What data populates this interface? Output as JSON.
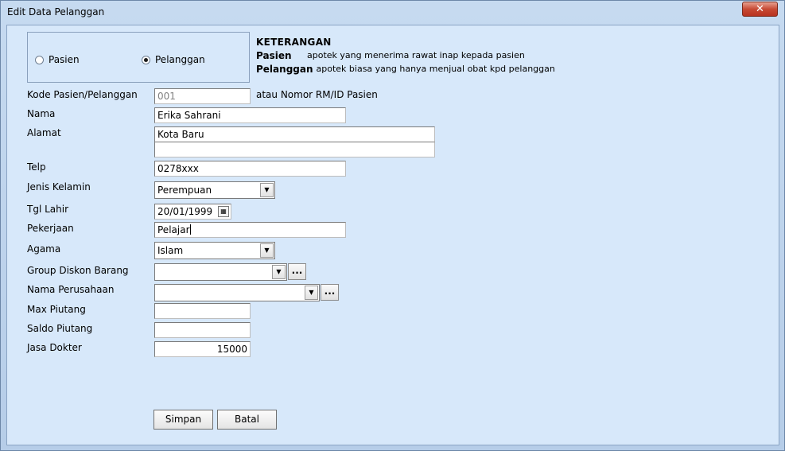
{
  "window": {
    "title": "Edit Data Pelanggan",
    "close_glyph": "✕"
  },
  "type_options": [
    {
      "label": "Pasien",
      "checked": false
    },
    {
      "label": "Pelanggan",
      "checked": true
    }
  ],
  "keterangan": {
    "title": "KETERANGAN",
    "rows": [
      {
        "term": "Pasien",
        "desc": "apotek yang menerima rawat inap kepada pasien"
      },
      {
        "term": "Pelanggan",
        "desc": "apotek biasa yang hanya menjual obat kpd pelanggan"
      }
    ]
  },
  "labels": {
    "kode": "Kode Pasien/Pelanggan",
    "kode_hint": "atau Nomor RM/ID Pasien",
    "nama": "Nama",
    "alamat": "Alamat",
    "telp": "Telp",
    "jenis_kelamin": "Jenis Kelamin",
    "tgl_lahir": "Tgl Lahir",
    "pekerjaan": "Pekerjaan",
    "agama": "Agama",
    "group_diskon": "Group Diskon Barang",
    "nama_perusahaan": "Nama Perusahaan",
    "max_piutang": "Max Piutang",
    "saldo_piutang": "Saldo Piutang",
    "jasa_dokter": "Jasa Dokter"
  },
  "values": {
    "kode": "001",
    "nama": "Erika Sahrani",
    "alamat_line1": "Kota Baru",
    "alamat_line2": "",
    "telp": "0278xxx",
    "jenis_kelamin": "Perempuan",
    "tgl_lahir": "20/01/1999",
    "pekerjaan": "Pelajar",
    "agama": "Islam",
    "group_diskon": "",
    "nama_perusahaan": "",
    "max_piutang": "",
    "saldo_piutang": "",
    "jasa_dokter": "15000"
  },
  "buttons": {
    "simpan": "Simpan",
    "batal": "Batal",
    "browse": "..."
  }
}
